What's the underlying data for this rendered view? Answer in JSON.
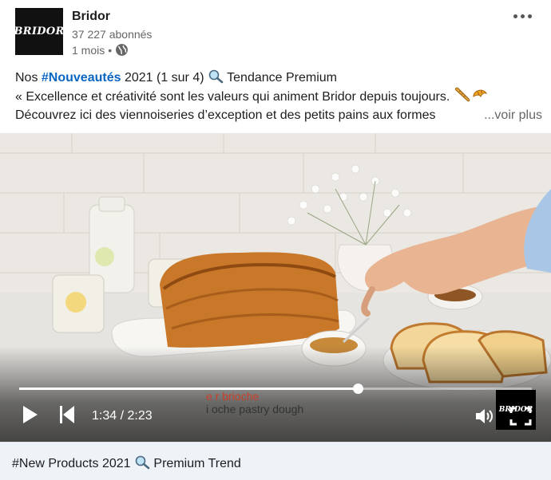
{
  "author": {
    "name": "Bridor",
    "logo_text": "BRIDOR",
    "followers": "37 227 abonnés",
    "time": "1 mois",
    "dot": "•"
  },
  "post": {
    "line1_pre": "Nos ",
    "line1_hashtag": "#Nouveautés",
    "line1_post": " 2021 (1 sur 4) ",
    "line1_emoji": "magnifying-glass-icon",
    "line1_tail": " Tendance Premium",
    "line2": "« Excellence et créativité sont les valeurs qui animent Bridor depuis toujours. ",
    "line2_emojis": [
      "baguette-icon",
      "croissant-icon"
    ],
    "line3": "Découvrez ici des viennoiseries d’exception et des petits pains aux formes",
    "see_more": "...voir plus"
  },
  "video": {
    "current_time": "1:34",
    "separator": " / ",
    "duration": "2:23",
    "progress_fraction": 0.66,
    "subtitle_line1": "e r brioche",
    "subtitle_line2": "i oche pastry dough",
    "watermark_text": "BRIDOR"
  },
  "caption": {
    "text_pre": "#New Products 2021 ",
    "emoji": "magnifying-glass-icon",
    "text_post": " Premium Trend"
  },
  "colors": {
    "hashtag": "#0a66c2",
    "caption_bg": "#eef3f8"
  }
}
